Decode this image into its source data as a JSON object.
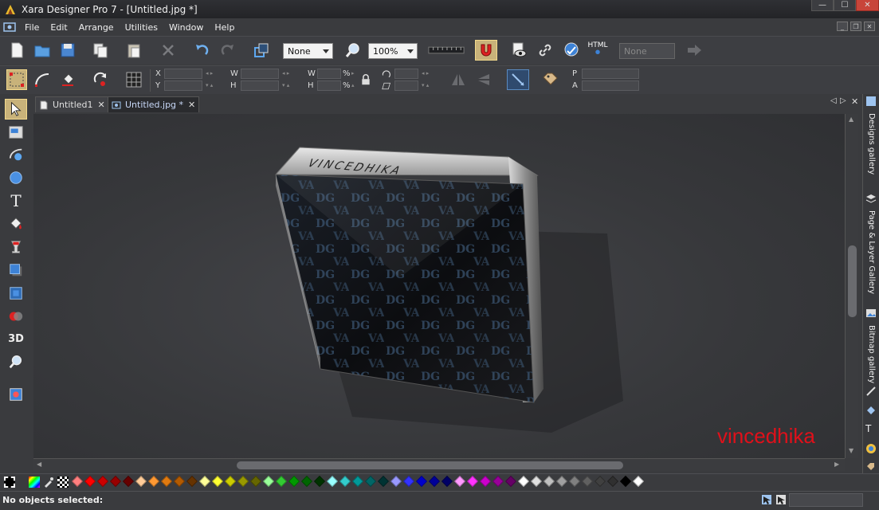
{
  "window": {
    "title": "Xara Designer Pro 7 - [Untitled.jpg *]",
    "minimize": "—",
    "maximize": "☐",
    "close": "✕"
  },
  "menu": [
    "File",
    "Edit",
    "Arrange",
    "Utilities",
    "Window",
    "Help"
  ],
  "toolbar": {
    "quality_select": "None",
    "zoom_select": "100%",
    "html_label": "HTML",
    "right_select": "None"
  },
  "infobar": {
    "x_label": "X",
    "y_label": "Y",
    "w_label": "W",
    "h_label": "H",
    "w2_label": "W",
    "h2_label": "H",
    "percent1": "%",
    "percent2": "%",
    "p_label": "P",
    "a_label": "A"
  },
  "tabs": [
    {
      "label": "Untitled1",
      "close": "✕",
      "active": false
    },
    {
      "label": "Untitled.jpg *",
      "close": "✕",
      "active": true
    }
  ],
  "tab_nav": {
    "prev": "◁",
    "next": "▷",
    "close": "✕"
  },
  "canvas": {
    "box_lid_text": "VINCEDHIKA",
    "watermark": "vincedhika"
  },
  "right_panels": [
    "Designs gallery",
    "Page & Layer Gallery",
    "Bitmap gallery"
  ],
  "palette_colors": [
    "#ff7f7f",
    "#ff0000",
    "#cc0000",
    "#990000",
    "#660000",
    "#ffcc99",
    "#ff9933",
    "#e07a10",
    "#b35a00",
    "#663300",
    "#ffff99",
    "#ffff33",
    "#cccc00",
    "#999900",
    "#666600",
    "#99ff99",
    "#33cc33",
    "#009900",
    "#006600",
    "#003300",
    "#99ffff",
    "#33cccc",
    "#009999",
    "#006666",
    "#003333",
    "#9999ff",
    "#3333ff",
    "#0000cc",
    "#000099",
    "#000066",
    "#ff99ff",
    "#ff33ff",
    "#cc00cc",
    "#990099",
    "#660066",
    "#ffffff",
    "#e0e0e0",
    "#c0c0c0",
    "#a0a0a0",
    "#808080",
    "#606060",
    "#404040",
    "#303030",
    "#000000",
    "#ffffff"
  ],
  "status": {
    "message": "No objects selected:"
  }
}
